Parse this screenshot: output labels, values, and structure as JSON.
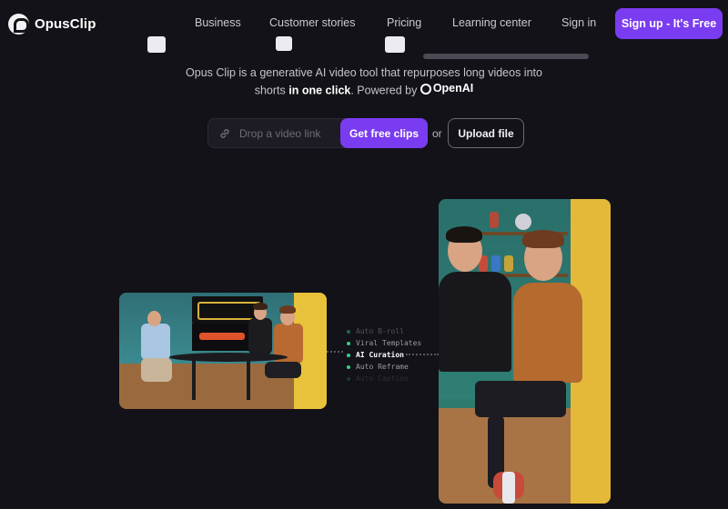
{
  "nav": {
    "logo_text": "OpusClip",
    "links": [
      "Business",
      "Customer stories",
      "Pricing",
      "Learning center",
      "Sign in"
    ],
    "signup_label": "Sign up - It's Free",
    "accent_color": "#7a3cf0"
  },
  "hero": {
    "description_part1": "Opus Clip is a generative AI video tool that repurposes long videos into",
    "description_part2": "shorts",
    "description_bold": "in one click",
    "description_part3": ". Powered by",
    "powered_by": "OpenAI"
  },
  "input": {
    "placeholder": "Drop a video link",
    "get_clips_label": "Get free clips",
    "or_text": "or",
    "upload_label": "Upload file"
  },
  "features": [
    {
      "label": "Auto B-roll",
      "state": "dim1"
    },
    {
      "label": "Viral Templates",
      "state": "normal"
    },
    {
      "label": "AI Curation",
      "state": "active"
    },
    {
      "label": "Auto Reframe",
      "state": "normal"
    },
    {
      "label": "Auto Caption",
      "state": "dim2"
    }
  ],
  "icons": {
    "link": "link-icon",
    "openai": "openai-icon"
  }
}
